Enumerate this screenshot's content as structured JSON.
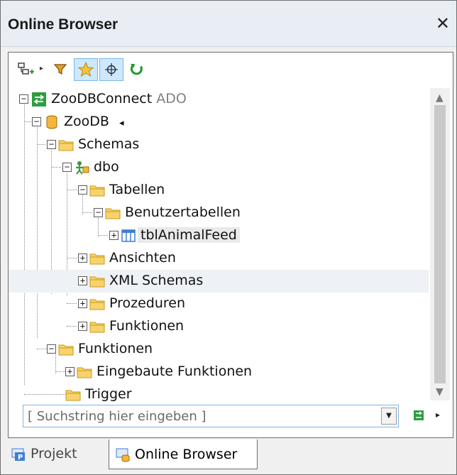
{
  "window": {
    "title": "Online Browser",
    "close_glyph": "✕"
  },
  "toolbar": {
    "buttons": [
      {
        "name": "add-datasource-button",
        "icon": "add-datasource-icon",
        "pressed": false
      },
      {
        "name": "filter-button",
        "icon": "filter-icon",
        "pressed": false
      },
      {
        "name": "favorites-button",
        "icon": "star-icon",
        "pressed": true
      },
      {
        "name": "locate-button",
        "icon": "crosshair-icon",
        "pressed": true
      },
      {
        "name": "refresh-button",
        "icon": "refresh-icon",
        "pressed": false
      }
    ]
  },
  "tree": {
    "nodes": [
      {
        "label": "ZooDBConnect",
        "suffix": "ADO",
        "icon": "connection-icon",
        "toggle": "−"
      },
      {
        "label": "ZooDB",
        "suffix": "◂",
        "icon": "database-icon",
        "toggle": "−"
      },
      {
        "label": "Schemas",
        "icon": "folder-icon",
        "toggle": "−"
      },
      {
        "label": "dbo",
        "icon": "schema-user-icon",
        "toggle": "−"
      },
      {
        "label": "Tabellen",
        "icon": "folder-icon",
        "toggle": "−"
      },
      {
        "label": "Benutzertabellen",
        "icon": "folder-icon",
        "toggle": "−"
      },
      {
        "label": "tblAnimalFeed",
        "icon": "table-icon",
        "toggle": "+",
        "selected": true
      },
      {
        "label": "Ansichten",
        "icon": "folder-icon",
        "toggle": "+"
      },
      {
        "label": "XML Schemas",
        "icon": "folder-icon",
        "toggle": "+",
        "highlighted": true
      },
      {
        "label": "Prozeduren",
        "icon": "folder-icon",
        "toggle": "+"
      },
      {
        "label": "Funktionen",
        "icon": "folder-icon",
        "toggle": "+"
      },
      {
        "label": "Funktionen",
        "icon": "folder-icon",
        "toggle": "−"
      },
      {
        "label": "Eingebaute Funktionen",
        "icon": "folder-icon",
        "toggle": "+"
      },
      {
        "label": "Trigger",
        "icon": "folder-icon",
        "toggle": ""
      }
    ]
  },
  "search": {
    "placeholder": "[ Suchstring hier eingeben ]",
    "value": ""
  },
  "tabs": [
    {
      "label": "Projekt",
      "icon": "project-icon",
      "active": false
    },
    {
      "label": "Online Browser",
      "icon": "online-browser-icon",
      "active": true
    }
  ],
  "colors": {
    "folder": "#f5c542",
    "connection": "#2e9d3f",
    "table": "#3f7fd0",
    "accent": "#7eb4ea"
  }
}
